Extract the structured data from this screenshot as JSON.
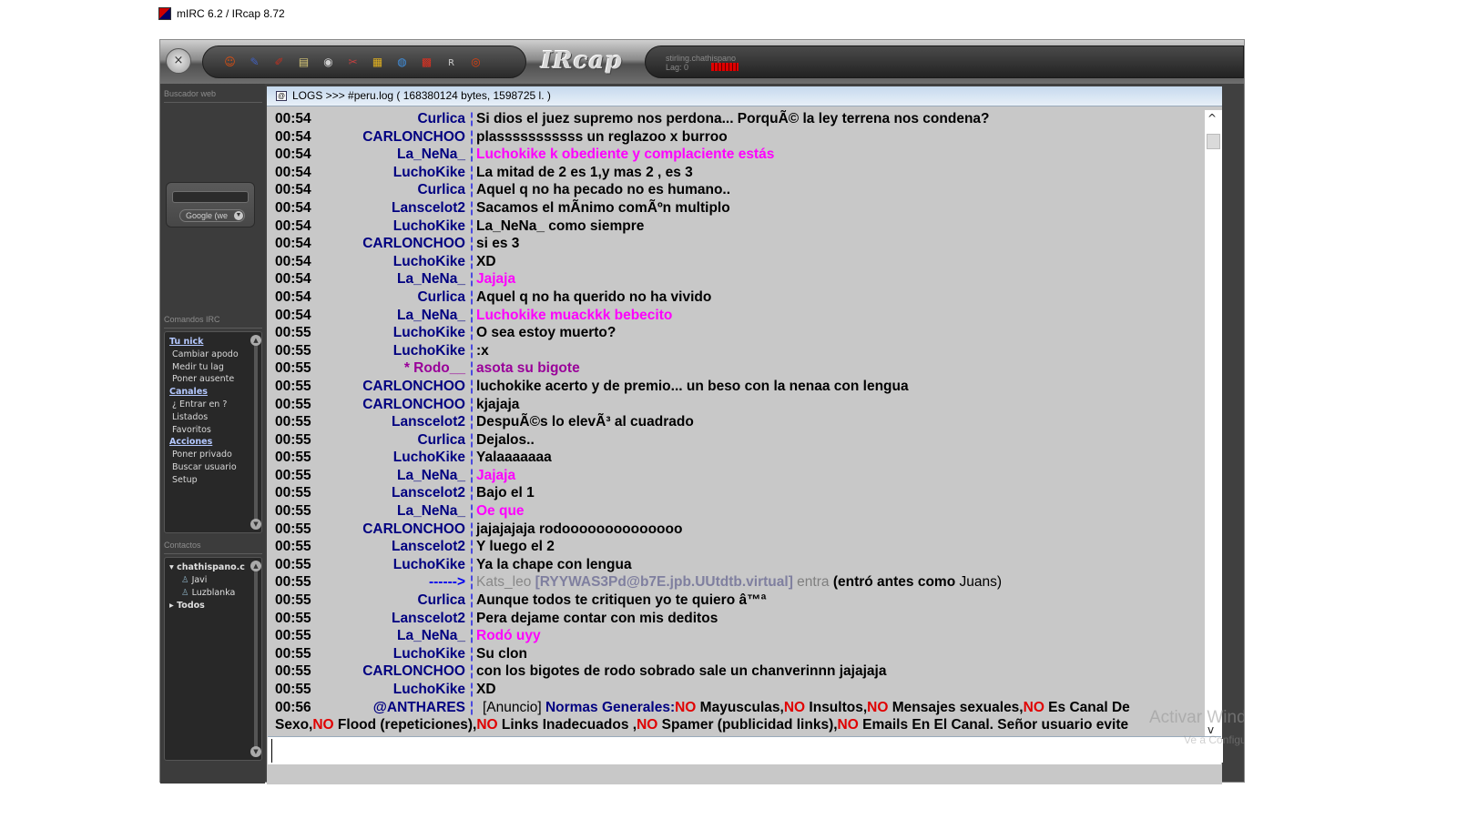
{
  "window_title": "mIRC 6.2 / IRcap 8.72",
  "toolbar": {
    "close_glyph": "×",
    "icons": [
      {
        "name": "smiley-icon",
        "glyph": "☺",
        "color": "#e05010"
      },
      {
        "name": "pin-icon",
        "glyph": "✎",
        "color": "#4060c0"
      },
      {
        "name": "pen-icon",
        "glyph": "✐",
        "color": "#c03020"
      },
      {
        "name": "notes-icon",
        "glyph": "▤",
        "color": "#d8c878"
      },
      {
        "name": "disc-icon",
        "glyph": "◉",
        "color": "#d0d0d0"
      },
      {
        "name": "tools-icon",
        "glyph": "✂",
        "color": "#c04040"
      },
      {
        "name": "gift-icon",
        "glyph": "▦",
        "color": "#e0b020"
      },
      {
        "name": "globe-icon",
        "glyph": "◍",
        "color": "#4090e0"
      },
      {
        "name": "grid-icon",
        "glyph": "▩",
        "color": "#e03020"
      },
      {
        "name": "ircap-icon",
        "glyph": "ʀ",
        "color": "#c0c0c0"
      },
      {
        "name": "lifebuoy-icon",
        "glyph": "◎",
        "color": "#e04010"
      }
    ],
    "logo": "IRcap",
    "server": "stirling.chathispano",
    "lag": "Lag: 0"
  },
  "sidebar": {
    "web_search_header": "Buscador web",
    "search_value": "",
    "search_engine": "Google (we",
    "irc_commands_header": "Comandos IRC",
    "commands": [
      {
        "label": "Tu nick",
        "type": "section"
      },
      {
        "label": "Cambiar apodo",
        "type": "item"
      },
      {
        "label": "Medir tu lag",
        "type": "item"
      },
      {
        "label": "Poner ausente",
        "type": "item"
      },
      {
        "label": "Canales",
        "type": "section"
      },
      {
        "label": "¿ Entrar en ?",
        "type": "item"
      },
      {
        "label": "Listados",
        "type": "item"
      },
      {
        "label": "Favoritos",
        "type": "item"
      },
      {
        "label": "Acciones",
        "type": "section"
      },
      {
        "label": "Poner privado",
        "type": "item"
      },
      {
        "label": "Buscar usuario",
        "type": "item"
      },
      {
        "label": "Setup",
        "type": "item"
      }
    ],
    "contacts_header": "Contactos",
    "contacts": {
      "group": "chathispano.c",
      "users": [
        "Javi",
        "Luzblanka"
      ],
      "all": "Todos"
    }
  },
  "log": {
    "title": "LOGS >>> #peru.log ( 168380124 bytes, 1598725 l. )",
    "messages": [
      {
        "time": "00:54",
        "nick": "Curlica",
        "text": "Si dios el juez supremo nos perdona... PorquÃ© la ley terrena nos condena?",
        "style": "normal"
      },
      {
        "time": "00:54",
        "nick": "CARLONCHOO",
        "text": "plasssssssssss un reglazoo x burroo",
        "style": "normal"
      },
      {
        "time": "00:54",
        "nick": "La_NeNa_",
        "text": "Luchokike k obediente y complaciente estás",
        "style": "pink"
      },
      {
        "time": "00:54",
        "nick": "LuchoKike",
        "text": "La mitad de 2 es 1,y mas 2 , es 3",
        "style": "normal"
      },
      {
        "time": "00:54",
        "nick": "Curlica",
        "text": "Aquel q no ha pecado no es humano..",
        "style": "normal"
      },
      {
        "time": "00:54",
        "nick": "Lanscelot2",
        "text": "Sacamos el mÃ­nimo comÃºn multiplo",
        "style": "normal"
      },
      {
        "time": "00:54",
        "nick": "LuchoKike",
        "text": "La_NeNa_ como siempre",
        "style": "normal"
      },
      {
        "time": "00:54",
        "nick": "CARLONCHOO",
        "text": "si es 3",
        "style": "normal"
      },
      {
        "time": "00:54",
        "nick": "LuchoKike",
        "text": "XD",
        "style": "normal"
      },
      {
        "time": "00:54",
        "nick": "La_NeNa_",
        "text": "Jajaja",
        "style": "pink"
      },
      {
        "time": "00:54",
        "nick": "Curlica",
        "text": "Aquel q no ha querido no ha vivido",
        "style": "normal"
      },
      {
        "time": "00:54",
        "nick": "La_NeNa_",
        "text": "Luchokike muackkk bebecito",
        "style": "pink"
      },
      {
        "time": "00:55",
        "nick": "LuchoKike",
        "text": "O sea estoy muerto?",
        "style": "normal"
      },
      {
        "time": "00:55",
        "nick": "LuchoKike",
        "text": ":x",
        "style": "normal"
      },
      {
        "time": "00:55",
        "nick": "* Rodo__",
        "text": "asota su bigote",
        "style": "purple"
      },
      {
        "time": "00:55",
        "nick": "CARLONCHOO",
        "text": "luchokike acerto y de premio... un beso con la nenaa con lengua",
        "style": "normal"
      },
      {
        "time": "00:55",
        "nick": "CARLONCHOO",
        "text": "kjajaja",
        "style": "normal"
      },
      {
        "time": "00:55",
        "nick": "Lanscelot2",
        "text": "DespuÃ©s lo elevÃ³ al cuadrado",
        "style": "normal"
      },
      {
        "time": "00:55",
        "nick": "Curlica",
        "text": "Dejalos..",
        "style": "normal"
      },
      {
        "time": "00:55",
        "nick": "LuchoKike",
        "text": "Yalaaaaaaa",
        "style": "normal"
      },
      {
        "time": "00:55",
        "nick": "La_NeNa_",
        "text": "Jajaja",
        "style": "pink"
      },
      {
        "time": "00:55",
        "nick": "Lanscelot2",
        "text": "Bajo el 1",
        "style": "normal"
      },
      {
        "time": "00:55",
        "nick": "La_NeNa_",
        "text": "Oe que",
        "style": "pink"
      },
      {
        "time": "00:55",
        "nick": "CARLONCHOO",
        "text": "jajajajaja rodoooooooooooooo",
        "style": "normal"
      },
      {
        "time": "00:55",
        "nick": "Lanscelot2",
        "text": "Y luego el 2",
        "style": "normal"
      },
      {
        "time": "00:55",
        "nick": "LuchoKike",
        "text": "Ya la chape con lengua",
        "style": "normal"
      },
      {
        "time": "00:55",
        "nick": "------>",
        "text": "",
        "style": "join",
        "join_user": "Kats_leo",
        "join_host": "[RYYWAS3Pd@b7E.jpb.UUtdtb.virtual]",
        "join_verb": "entra",
        "join_note": "(entró antes como",
        "join_prev": "Juans)"
      },
      {
        "time": "00:55",
        "nick": "Curlica",
        "text": "Aunque todos te critiquen yo te quiero â™ª",
        "style": "normal"
      },
      {
        "time": "00:55",
        "nick": "Lanscelot2",
        "text": "Pera dejame contar con mis deditos",
        "style": "normal"
      },
      {
        "time": "00:55",
        "nick": "La_NeNa_",
        "text": "Rodó uyy",
        "style": "pink"
      },
      {
        "time": "00:55",
        "nick": "LuchoKike",
        "text": "Su clon",
        "style": "normal"
      },
      {
        "time": "00:55",
        "nick": "CARLONCHOO",
        "text": "con los bigotes de rodo sobrado sale un chanverinnn jajajaja",
        "style": "normal"
      },
      {
        "time": "00:55",
        "nick": "LuchoKike",
        "text": "XD",
        "style": "normal"
      }
    ],
    "announcement": {
      "time": "00:56",
      "nick": "@ANTHARES",
      "tag": "[Anuncio]",
      "heading": "Normas Generales:",
      "parts": [
        {
          "no": "NO",
          "text": " Mayusculas,"
        },
        {
          "no": "NO",
          "text": " Insultos,"
        },
        {
          "no": "NO",
          "text": " Mensajes sexuales,"
        },
        {
          "no": "NO",
          "text": " Es Canal De Sexo,"
        },
        {
          "no": "NO",
          "text": " Flood (repeticiones),"
        },
        {
          "no": "NO",
          "text": " Links Inadecuados ,"
        },
        {
          "no": "NO",
          "text": " Spamer (publicidad links),"
        },
        {
          "no": "NO",
          "text": " Emails En El Canal. Señor usuario evite"
        }
      ]
    },
    "input_value": ""
  },
  "watermark": {
    "line1": "Activar Windows",
    "line2": "Ve a Configuración"
  },
  "colors": {
    "nick": "#000080",
    "pink": "#ff00ff",
    "purple": "#990099",
    "red": "#e00000",
    "separator": "#0000ee"
  }
}
